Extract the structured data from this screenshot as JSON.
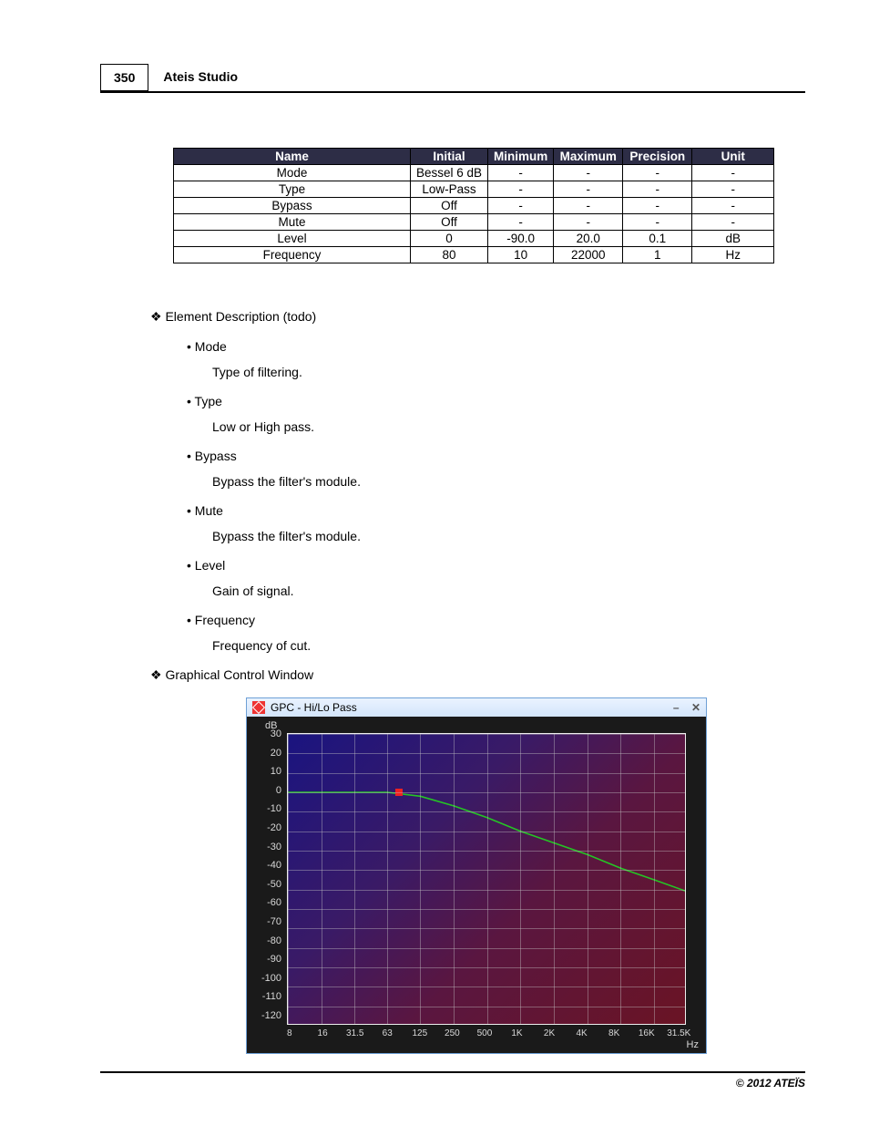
{
  "header": {
    "page_number": "350",
    "title": "Ateis Studio"
  },
  "table": {
    "headers": [
      "Name",
      "Initial",
      "Minimum",
      "Maximum",
      "Precision",
      "Unit"
    ],
    "rows": [
      {
        "name": "Mode",
        "initial": "Bessel 6 dB",
        "minimum": "-",
        "maximum": "-",
        "precision": "-",
        "unit": "-"
      },
      {
        "name": "Type",
        "initial": "Low-Pass",
        "minimum": "-",
        "maximum": "-",
        "precision": "-",
        "unit": "-"
      },
      {
        "name": "Bypass",
        "initial": "Off",
        "minimum": "-",
        "maximum": "-",
        "precision": "-",
        "unit": "-"
      },
      {
        "name": "Mute",
        "initial": "Off",
        "minimum": "-",
        "maximum": "-",
        "precision": "-",
        "unit": "-"
      },
      {
        "name": "Level",
        "initial": "0",
        "minimum": "-90.0",
        "maximum": "20.0",
        "precision": "0.1",
        "unit": "dB"
      },
      {
        "name": "Frequency",
        "initial": "80",
        "minimum": "10",
        "maximum": "22000",
        "precision": "1",
        "unit": "Hz"
      }
    ]
  },
  "sections": {
    "element_description": {
      "title": "Element Description (todo)",
      "items": [
        {
          "label": "Mode",
          "desc": "Type of filtering."
        },
        {
          "label": "Type",
          "desc": "Low or High pass."
        },
        {
          "label": "Bypass",
          "desc": "Bypass the filter's module."
        },
        {
          "label": "Mute",
          "desc": "Bypass the filter's module."
        },
        {
          "label": "Level",
          "desc": "Gain of signal."
        },
        {
          "label": "Frequency",
          "desc": "Frequency of cut."
        }
      ]
    },
    "graphical": {
      "title": "Graphical Control Window",
      "window_title": "GPC - Hi/Lo Pass",
      "minimize": "–",
      "close": "✕"
    }
  },
  "chart_data": {
    "type": "line",
    "title": "GPC - Hi/Lo Pass",
    "xlabel": "Hz",
    "ylabel": "dB",
    "x_ticks": [
      "8",
      "16",
      "31.5",
      "63",
      "125",
      "250",
      "500",
      "1K",
      "2K",
      "4K",
      "8K",
      "16K",
      "31.5K"
    ],
    "y_ticks": [
      30,
      20,
      10,
      0,
      -10,
      -20,
      -30,
      -40,
      -50,
      -60,
      -70,
      -80,
      -90,
      -100,
      -110,
      -120
    ],
    "ylim": [
      -120,
      30
    ],
    "x": [
      8,
      16,
      31.5,
      63,
      125,
      250,
      500,
      1000,
      2000,
      4000,
      8000,
      16000,
      31500
    ],
    "values": [
      0,
      0,
      0,
      0,
      -2,
      -7,
      -13,
      -20,
      -26,
      -32,
      -39,
      -45,
      -51
    ],
    "marker_at": {
      "x": 80,
      "y": 0
    },
    "curve_color": "#25c425"
  },
  "footer": "© 2012 ATEÏS"
}
